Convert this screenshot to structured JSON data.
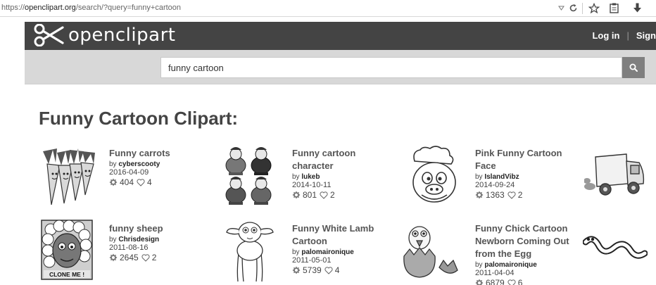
{
  "browser": {
    "url_prefix": "https://",
    "url_domain": "openclipart.org",
    "url_path": "/search/?query=funny+cartoon"
  },
  "header": {
    "logo_text": "openclipart",
    "login": "Log in",
    "separator": "|",
    "signup_partial": "Sign"
  },
  "search": {
    "value": "funny cartoon",
    "button_icon": "search-icon"
  },
  "page_title": "Funny Cartoon Clipart:",
  "results": [
    {
      "title": "Funny carrots",
      "by": "by ",
      "author": "cyberscooty",
      "date": "2016-04-09",
      "downloads": "404",
      "favorites": "4",
      "thumb": "carrots"
    },
    {
      "title": "Funny cartoon character",
      "by": "by ",
      "author": "lukeb",
      "date": "2014-10-11",
      "downloads": "801",
      "favorites": "2",
      "thumb": "characters"
    },
    {
      "title": "Pink Funny Cartoon Face",
      "by": "by ",
      "author": "IslandVibz",
      "date": "2014-09-24",
      "downloads": "1363",
      "favorites": "2",
      "thumb": "face"
    },
    {
      "title": "funny sheep",
      "by": "by ",
      "author": "Chrisdesign",
      "date": "2011-08-16",
      "downloads": "2645",
      "favorites": "2",
      "thumb": "sheep",
      "thumb_caption": "CLONE ME !"
    },
    {
      "title": "Funny White Lamb Cartoon",
      "by": "by ",
      "author": "palomaironique",
      "date": "2011-05-01",
      "downloads": "5739",
      "favorites": "4",
      "thumb": "lamb"
    },
    {
      "title": "Funny Chick Cartoon Newborn Coming Out from the Egg",
      "by": "by ",
      "author": "palomaironique",
      "date": "2011-04-04",
      "downloads": "6879",
      "favorites": "6",
      "thumb": "chick"
    }
  ]
}
